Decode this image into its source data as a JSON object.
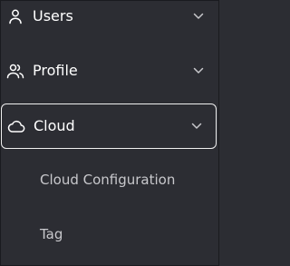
{
  "sidebar": {
    "items": [
      {
        "label": "Users",
        "icon": "user-icon",
        "expanded": false,
        "selected": false
      },
      {
        "label": "Profile",
        "icon": "users-icon",
        "expanded": false,
        "selected": false
      },
      {
        "label": "Cloud",
        "icon": "cloud-icon",
        "expanded": true,
        "selected": true,
        "children": [
          {
            "label": "Cloud Configuration"
          },
          {
            "label": "Tag"
          }
        ]
      }
    ]
  },
  "colors": {
    "background": "#2c2d33",
    "text": "#ffffff",
    "subtext": "#c8c8cc",
    "focus_border": "#f0f0f0"
  }
}
